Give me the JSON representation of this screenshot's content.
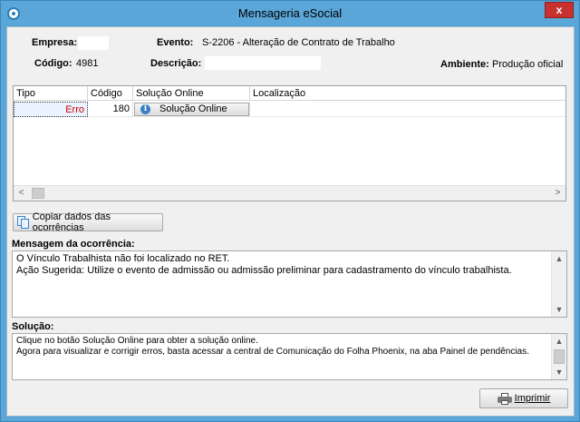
{
  "window": {
    "title": "Mensageria eSocial",
    "close_label": "x"
  },
  "header": {
    "empresa_label": "Empresa:",
    "empresa_value": "",
    "evento_label": "Evento:",
    "evento_value": "S-2206 - Alteração de Contrato de Trabalho",
    "codigo_label": "Código:",
    "codigo_value": "4981",
    "descricao_label": "Descrição:",
    "descricao_value": "",
    "ambiente_label": "Ambiente:",
    "ambiente_value": "Produção oficial"
  },
  "grid": {
    "columns": [
      "Tipo",
      "Código",
      "Solução Online",
      "Localização"
    ],
    "rows": [
      {
        "tipo": "Erro",
        "codigo": "180",
        "solucao": "Solução Online",
        "localizacao": ""
      }
    ],
    "scroll_left": "<",
    "scroll_right": ">"
  },
  "copy_button_label": "Copiar dados das ocorrências",
  "mensagem": {
    "title": "Mensagem da ocorrência:",
    "lines": [
      "O Vínculo Trabalhista não foi localizado no RET.",
      "Ação Sugerida: Utilize o evento de admissão ou admissão preliminar para cadastramento do vínculo trabalhista."
    ]
  },
  "solucao": {
    "title": "Solução:",
    "lines": [
      "Clique no botão Solução Online para obter a solução online.",
      "Agora para visualizar e corrigir erros, basta acessar a central de Comunicação do Folha Phoenix, na aba Painel de pendências."
    ]
  },
  "print_button_label": "Imprimir",
  "icons": {
    "app": "esocial-app-icon",
    "info": "info-icon",
    "copy": "copy-icon",
    "printer": "printer-icon"
  },
  "colors": {
    "titlebar": "#5aa6d8",
    "close": "#c7322f",
    "error_text": "#d00000",
    "info_icon": "#3c7fc8"
  }
}
